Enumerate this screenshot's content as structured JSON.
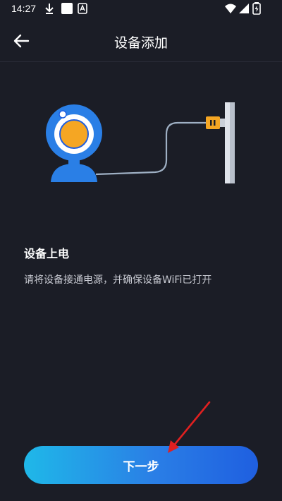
{
  "status_bar": {
    "time": "14:27"
  },
  "header": {
    "title": "设备添加",
    "back_icon": "arrow-left-icon"
  },
  "step": {
    "title": "设备上电",
    "description": "请将设备接通电源，并确保设备WiFi已打开"
  },
  "actions": {
    "next_label": "下一步"
  },
  "colors": {
    "background": "#1b1d26",
    "accent_blue": "#2a7fe6",
    "camera_orange": "#f5a623",
    "annotation_red": "#e02020"
  }
}
